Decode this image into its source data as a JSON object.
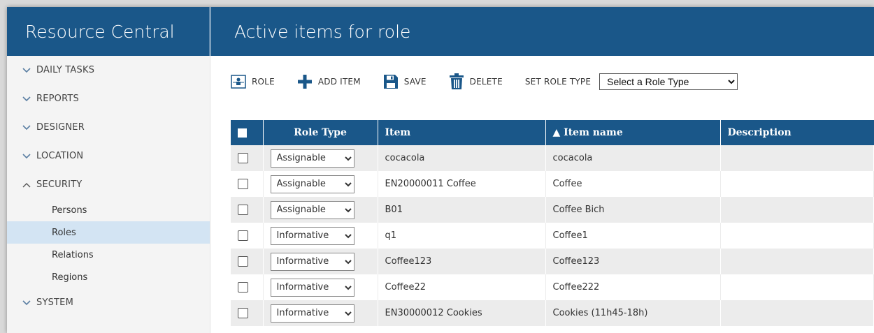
{
  "app": {
    "title": "Resource Central"
  },
  "page": {
    "title": "Active items for role"
  },
  "sidebar": {
    "sections": [
      {
        "label": "DAILY TASKS",
        "expanded": false
      },
      {
        "label": "REPORTS",
        "expanded": false
      },
      {
        "label": "DESIGNER",
        "expanded": false
      },
      {
        "label": "LOCATION",
        "expanded": false
      },
      {
        "label": "SECURITY",
        "expanded": true,
        "items": [
          {
            "label": "Persons",
            "active": false
          },
          {
            "label": "Roles",
            "active": true
          },
          {
            "label": "Relations",
            "active": false
          },
          {
            "label": "Regions",
            "active": false
          }
        ]
      },
      {
        "label": "SYSTEM",
        "expanded": false
      }
    ]
  },
  "toolbar": {
    "role_label": "ROLE",
    "add_item_label": "ADD ITEM",
    "save_label": "SAVE",
    "delete_label": "DELETE",
    "set_role_type_label": "SET ROLE TYPE",
    "role_type_select": "Select a Role Type"
  },
  "grid": {
    "columns": [
      "Role Type",
      "Item",
      "▲ Item name",
      "Description"
    ],
    "rows": [
      {
        "role_type": "Assignable",
        "item": "cocacola",
        "item_name": "cocacola",
        "description": ""
      },
      {
        "role_type": "Assignable",
        "item": "EN20000011 Coffee",
        "item_name": "Coffee",
        "description": ""
      },
      {
        "role_type": "Assignable",
        "item": "B01",
        "item_name": "Coffee Bich",
        "description": ""
      },
      {
        "role_type": "Informative",
        "item": "q1",
        "item_name": "Coffee1",
        "description": ""
      },
      {
        "role_type": "Informative",
        "item": "Coffee123",
        "item_name": "Coffee123",
        "description": ""
      },
      {
        "role_type": "Informative",
        "item": "Coffee22",
        "item_name": "Coffee222",
        "description": ""
      },
      {
        "role_type": "Informative",
        "item": "EN30000012 Cookies",
        "item_name": "Cookies (11h45-18h)",
        "description": ""
      }
    ]
  },
  "colors": {
    "header_bg": "#1a5789",
    "active_nav": "#d3e4f3",
    "row_alt": "#ececec"
  },
  "icons": {
    "role": "role-icon",
    "add": "plus-icon",
    "save": "floppy-disk-icon",
    "delete": "trash-icon"
  }
}
